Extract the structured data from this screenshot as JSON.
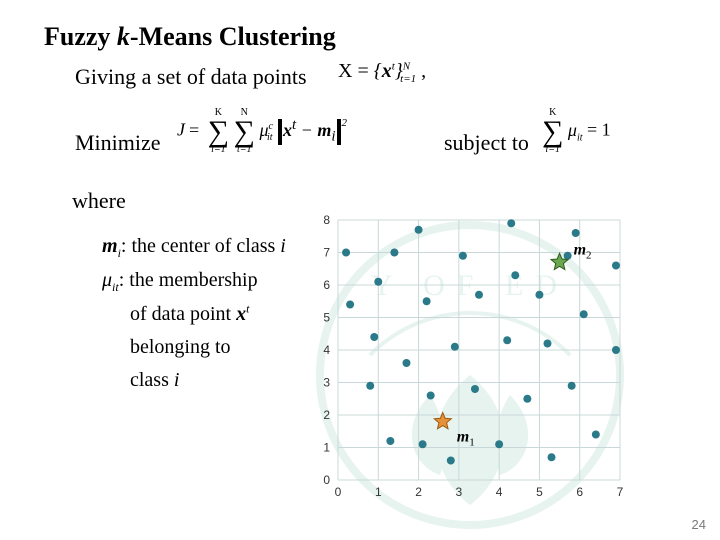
{
  "title_a": "Fuzzy ",
  "title_k": "k",
  "title_b": "-Means Clustering",
  "line1": "Giving a set of data points",
  "formula_x": "X = {xᵗ}ᴺₜ₌₁,",
  "line2_minimize": "Minimize",
  "line2_subject": "subject to",
  "formula_j": {
    "J": "J",
    "sum1_top": "K",
    "sum1_bot": "i=1",
    "sum2_top": "N",
    "sum2_bot": "t=1",
    "mu": "μ",
    "mu_sub": "it",
    "mu_sup": "c",
    "xt": "x",
    "xt_sup": "t",
    "minus": " − ",
    "mi": "m",
    "mi_sub": "i",
    "sq": "2"
  },
  "formula_c": {
    "sum_top": "K",
    "sum_bot": "i=1",
    "mu": "μ",
    "mu_sub": "it",
    "eq1": " = 1"
  },
  "where": "where",
  "defs": {
    "row1_a": "m",
    "row1_sub": "i",
    "row1_b": ": the center of class ",
    "row1_c": "i",
    "row2_a": "μ",
    "row2_sub": "it",
    "row2_b": ": the membership",
    "row3_a": "of data point ",
    "row3_b": "x",
    "row3_sup": "t",
    "row4": "belonging to",
    "row5_a": "class ",
    "row5_b": "i"
  },
  "page_number": "24",
  "chart_data": {
    "type": "scatter",
    "xlim": [
      0,
      7
    ],
    "ylim": [
      0,
      8
    ],
    "xticks": [
      0,
      1,
      2,
      3,
      4,
      5,
      6,
      7
    ],
    "yticks": [
      0,
      1,
      2,
      3,
      4,
      5,
      6,
      7,
      8
    ],
    "points": [
      {
        "x": 0.2,
        "y": 7.0
      },
      {
        "x": 0.3,
        "y": 5.4
      },
      {
        "x": 0.8,
        "y": 2.9
      },
      {
        "x": 0.9,
        "y": 4.4
      },
      {
        "x": 1.0,
        "y": 6.1
      },
      {
        "x": 1.3,
        "y": 1.2
      },
      {
        "x": 1.4,
        "y": 7.0
      },
      {
        "x": 1.7,
        "y": 3.6
      },
      {
        "x": 2.0,
        "y": 7.7
      },
      {
        "x": 2.1,
        "y": 1.1
      },
      {
        "x": 2.2,
        "y": 5.5
      },
      {
        "x": 2.3,
        "y": 2.6
      },
      {
        "x": 2.8,
        "y": 0.6
      },
      {
        "x": 2.9,
        "y": 4.1
      },
      {
        "x": 3.1,
        "y": 6.9
      },
      {
        "x": 3.4,
        "y": 2.8
      },
      {
        "x": 3.5,
        "y": 5.7
      },
      {
        "x": 4.0,
        "y": 1.1
      },
      {
        "x": 4.2,
        "y": 4.3
      },
      {
        "x": 4.3,
        "y": 7.9
      },
      {
        "x": 4.4,
        "y": 6.3
      },
      {
        "x": 4.7,
        "y": 2.5
      },
      {
        "x": 5.0,
        "y": 5.7
      },
      {
        "x": 5.2,
        "y": 4.2
      },
      {
        "x": 5.3,
        "y": 0.7
      },
      {
        "x": 5.7,
        "y": 6.9
      },
      {
        "x": 5.8,
        "y": 2.9
      },
      {
        "x": 5.9,
        "y": 7.6
      },
      {
        "x": 6.1,
        "y": 5.1
      },
      {
        "x": 6.4,
        "y": 1.4
      },
      {
        "x": 6.9,
        "y": 4.0
      },
      {
        "x": 6.9,
        "y": 6.6
      }
    ],
    "centers": [
      {
        "name": "m1",
        "x": 2.6,
        "y": 1.8,
        "label": "m",
        "sub": "1"
      },
      {
        "name": "m2",
        "x": 5.5,
        "y": 6.7,
        "label": "m",
        "sub": "2"
      }
    ]
  }
}
